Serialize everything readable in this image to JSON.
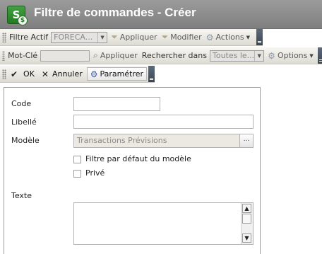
{
  "window": {
    "title": "Filtre de commandes - Créer"
  },
  "toolbar1": {
    "filter_label": "Filtre Actif",
    "filter_value": "FORECA...",
    "apply_label": "Appliquer",
    "modify_label": "Modifier",
    "actions_label": "Actions"
  },
  "toolbar2": {
    "keyword_label": "Mot-Clé",
    "keyword_value": "",
    "apply_label": "Appliquer",
    "search_in_label": "Rechercher dans",
    "search_in_value": "Toutes le...",
    "options_label": "Options"
  },
  "toolbar3": {
    "ok_label": "OK",
    "cancel_label": "Annuler",
    "settings_label": "Paramétrer"
  },
  "form": {
    "code_label": "Code",
    "code_value": "",
    "libelle_label": "Libellé",
    "libelle_value": "",
    "model_label": "Modèle",
    "model_value": "Transactions Prévisions",
    "browse_label": "...",
    "default_filter_label": "Filtre par défaut du modèle",
    "default_filter_checked": false,
    "private_label": "Privé",
    "private_checked": false,
    "text_label": "Texte",
    "text_value": ""
  },
  "colors": {
    "titlebar": "#8a8a8a",
    "toolbar": "#e8e7e1",
    "app_icon": "#2f8a2e"
  }
}
